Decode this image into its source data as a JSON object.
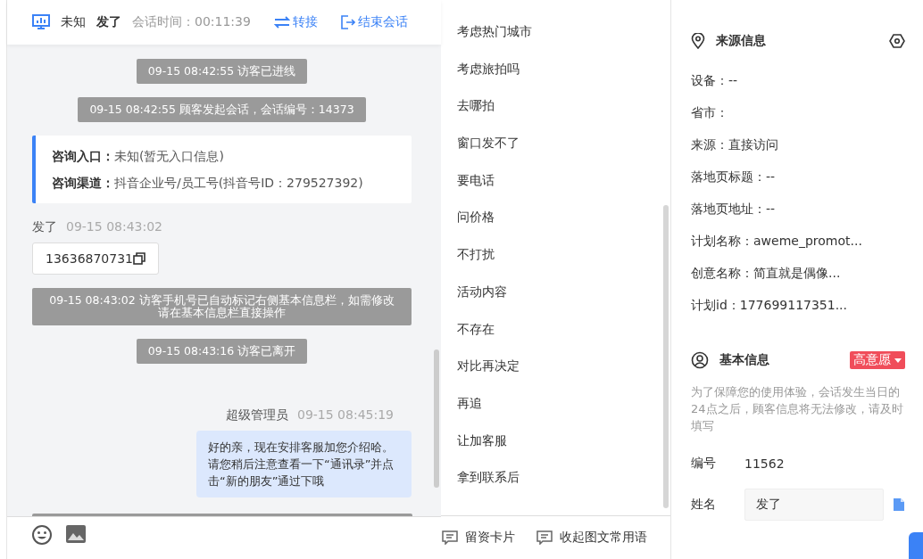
{
  "header": {
    "visitor_type": "未知",
    "visitor_name": "发了",
    "duration": "会话时间：00:11:39",
    "actions": [
      {
        "kind": "transfer",
        "label": "转接"
      },
      {
        "kind": "end",
        "label": "结束会话"
      }
    ]
  },
  "messages": [
    {
      "kind": "system",
      "text": "09-15 08:42:55 访客已进线"
    },
    {
      "kind": "system",
      "text": "09-15 08:42:55 顾客发起会话，会话编号：14373"
    },
    {
      "kind": "entry",
      "lines": [
        "**咨询入口：**未知(暂无入口信息)",
        "**咨询渠道：**抖音企业号/员工号(抖音号ID：279527392)"
      ]
    },
    {
      "kind": "visitor",
      "sender": "发了",
      "time": "09-15 08:43:02",
      "text": "13636870731"
    },
    {
      "kind": "system",
      "text": "09-15 08:43:02 访客手机号已自动标记右侧基本信息栏，如需修改请在基本信息栏直接操作"
    },
    {
      "kind": "system",
      "text": "09-15 08:43:16 访客已离开"
    },
    {
      "kind": "agent",
      "sender": "超级管理员",
      "time": "09-15 08:45:19",
      "text": "好的亲，现在安排客服加您介绍哈。请您稍后注意查看一下“通讯录”并点击“新的朋友”通过下哦"
    }
  ],
  "phrases": [
    "考虑热门城市",
    "考虑旅拍吗",
    "去哪拍",
    "窗口发不了",
    "要电话",
    "问价格",
    "不打扰",
    "活动内容",
    "不存在",
    "对比再决定",
    "再追",
    "让加客服",
    "拿到联系后"
  ],
  "phrase_actions": [
    "留资卡片",
    "收起图文常用语"
  ],
  "source_info": {
    "title": "来源信息",
    "fields": [
      "设备：--",
      "省市：",
      "来源：直接访问",
      "落地页标题：--",
      "落地页地址：--",
      "计划名称：aweme_promot...",
      "创意名称：简直就是偶像...",
      "计划id：177699117351..."
    ]
  },
  "basic_info": {
    "title": "基本信息",
    "intent": "高意愿",
    "notice": "为了保障您的使用体验，会话发生当日的24点之后，顾客信息将无法修改，请及时填写",
    "number_label": "编号",
    "number": "11562",
    "name_label": "姓名",
    "name": "发了"
  }
}
